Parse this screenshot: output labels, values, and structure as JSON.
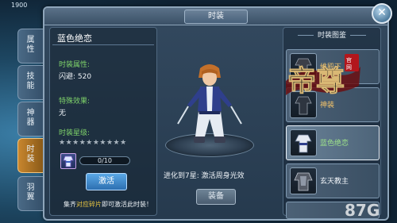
{
  "background": {
    "top_number": "1900"
  },
  "dialog": {
    "title": "时装"
  },
  "tabs": [
    {
      "label": [
        "属",
        "性"
      ]
    },
    {
      "label": [
        "技",
        "能"
      ]
    },
    {
      "label": [
        "神",
        "器"
      ]
    },
    {
      "label": [
        "时",
        "装"
      ],
      "active": true
    },
    {
      "label": [
        "羽",
        "翼"
      ]
    }
  ],
  "costume": {
    "name": "蓝色绝恋",
    "attr_label": "时装属性:",
    "attr_value": "闪避: 520",
    "effect_label": "特殊效果:",
    "effect_value": "无",
    "star_label": "时装星级:",
    "stars": "★★★★★★★★★★",
    "stars_filled": 0,
    "stars_total": 10,
    "progress_text": "0/10",
    "progress_fraction": 0,
    "activate_button": "激活",
    "hint_prefix": "集齐",
    "hint_highlight": "对应碎片",
    "hint_suffix": "即可激活此时装！"
  },
  "preview": {
    "evolve_text": "进化到7星: 激活周身光效",
    "equip_button": "装备"
  },
  "list": {
    "header": "时装图鉴",
    "items": [
      {
        "name": "维殿下",
        "name_color": "orange"
      },
      {
        "name": "神装",
        "name_color": "orange"
      },
      {
        "name": "蓝色绝恋",
        "name_color": "green",
        "selected": true
      },
      {
        "name": "玄天教主",
        "name_color": "white"
      },
      {
        "name": "",
        "name_color": "white"
      }
    ]
  },
  "overlay": {
    "logo_text": "帝尊",
    "logo_badge": "官网",
    "watermark": "87G.com"
  },
  "colors": {
    "dialog_bg": "#2c4256",
    "active_tab": "#c8862e",
    "label_green": "#7fd36a",
    "button_blue": "#3d86c8",
    "highlight_yellow": "#e9c642"
  }
}
